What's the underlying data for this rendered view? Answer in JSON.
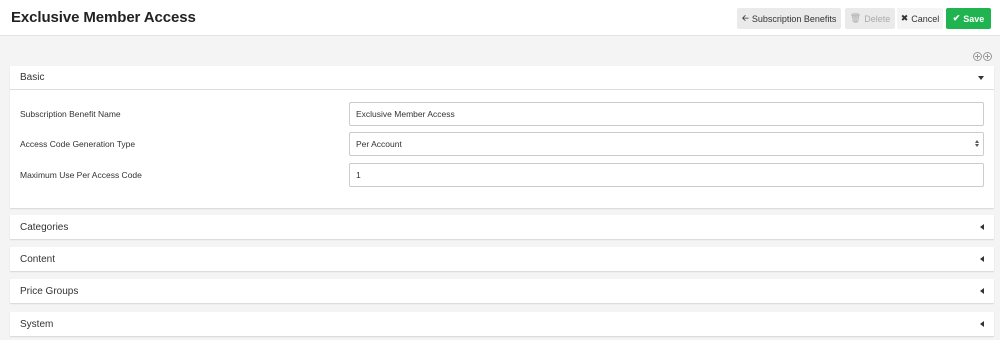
{
  "header": {
    "title": "Exclusive Member Access",
    "buttons": {
      "subscription_benefits": "Subscription Benefits",
      "delete": "Delete",
      "cancel": "Cancel",
      "save": "Save"
    }
  },
  "sections": {
    "basic": {
      "title": "Basic",
      "fields": [
        {
          "label": "Subscription Benefit Name",
          "value": "Exclusive Member Access"
        },
        {
          "label": "Access Code Generation Type",
          "value": "Per Account"
        },
        {
          "label": "Maximum Use Per Access Code",
          "value": "1"
        }
      ]
    },
    "categories": {
      "title": "Categories"
    },
    "content": {
      "title": "Content"
    },
    "price_groups": {
      "title": "Price Groups"
    },
    "system": {
      "title": "System"
    }
  },
  "colors": {
    "save_button": "#1fb44f",
    "page_background": "#f4f4f4"
  },
  "icons": {
    "back": "arrow-left-icon",
    "delete": "trash-icon",
    "cancel": "x-icon",
    "save": "check-icon",
    "expand_all": "plus-circle-icon",
    "collapse_all": "minus-circle-icon"
  }
}
